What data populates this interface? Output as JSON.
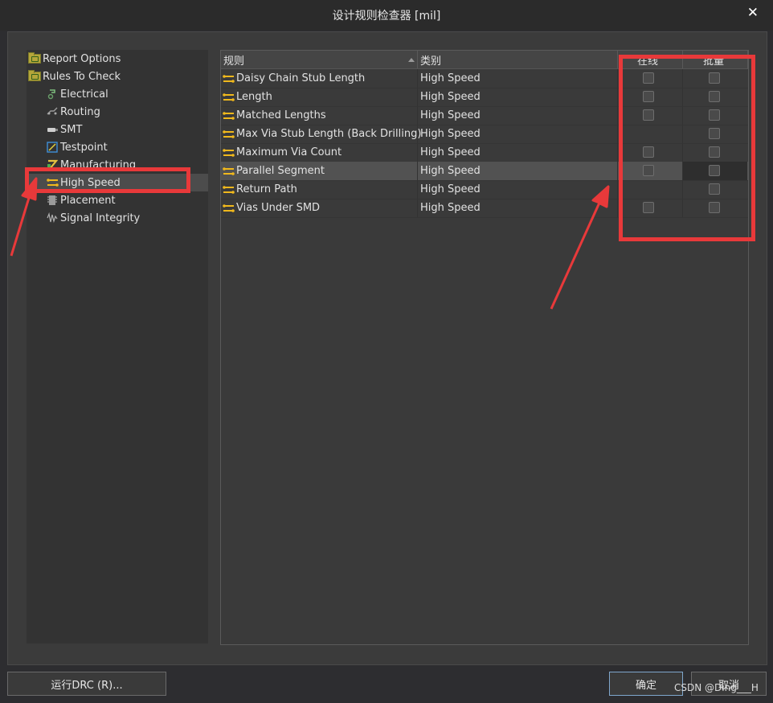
{
  "window": {
    "title": "设计规则检查器 [mil]",
    "close_glyph": "✕"
  },
  "tree": {
    "items": [
      {
        "label": "Report Options",
        "icon": "folder-icon"
      },
      {
        "label": "Rules To Check",
        "icon": "folder-icon"
      },
      {
        "label": "Electrical",
        "icon": "electrical-icon"
      },
      {
        "label": "Routing",
        "icon": "routing-icon"
      },
      {
        "label": "SMT",
        "icon": "smt-icon"
      },
      {
        "label": "Testpoint",
        "icon": "testpoint-icon"
      },
      {
        "label": "Manufacturing",
        "icon": "manufacturing-icon"
      },
      {
        "label": "High Speed",
        "icon": "high-speed-icon",
        "selected": true
      },
      {
        "label": "Placement",
        "icon": "placement-icon"
      },
      {
        "label": "Signal Integrity",
        "icon": "signal-integrity-icon"
      }
    ]
  },
  "table": {
    "columns": [
      "规则",
      "类别",
      "在线",
      "批量"
    ],
    "rows": [
      {
        "rule": "Daisy Chain Stub Length",
        "category": "High Speed",
        "online": true,
        "batch": true
      },
      {
        "rule": "Length",
        "category": "High Speed",
        "online": true,
        "batch": true
      },
      {
        "rule": "Matched Lengths",
        "category": "High Speed",
        "online": true,
        "batch": true
      },
      {
        "rule": "Max Via Stub Length (Back Drilling)",
        "category": "High Speed",
        "online": false,
        "batch": true
      },
      {
        "rule": "Maximum Via Count",
        "category": "High Speed",
        "online": true,
        "batch": true
      },
      {
        "rule": "Parallel Segment",
        "category": "High Speed",
        "online": true,
        "batch": true,
        "selected": true
      },
      {
        "rule": "Return Path",
        "category": "High Speed",
        "online": false,
        "batch": true
      },
      {
        "rule": "Vias Under SMD",
        "category": "High Speed",
        "online": true,
        "batch": true
      }
    ]
  },
  "buttons": {
    "run_drc": "运行DRC (R)...",
    "ok": "确定",
    "cancel": "取消"
  },
  "watermark": "CSDN @Ding___H",
  "colors": {
    "highlight": "#e8393a",
    "accent_button": "#7fa6cc"
  }
}
